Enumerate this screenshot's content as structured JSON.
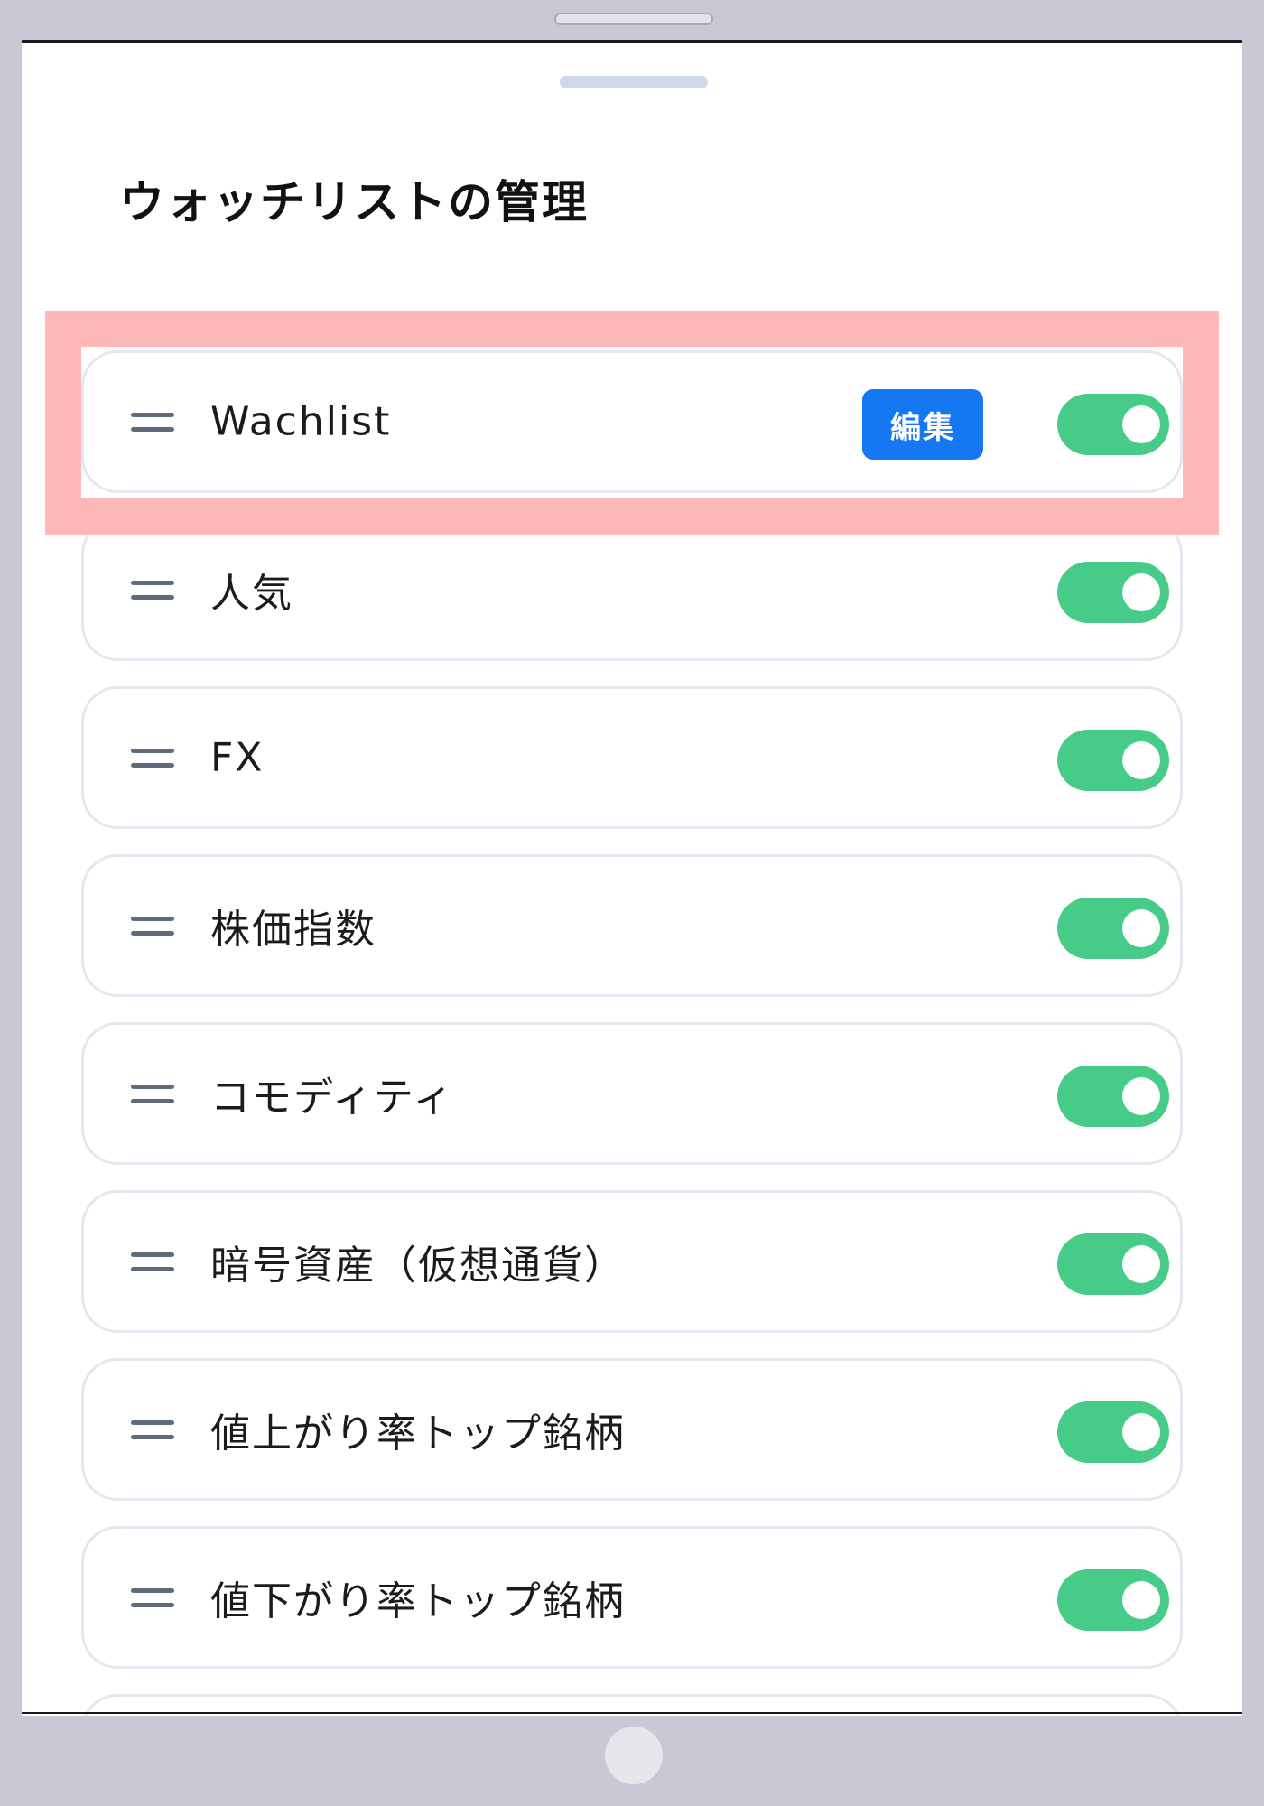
{
  "sheet": {
    "title": "ウォッチリストの管理"
  },
  "watchlists": [
    {
      "label": "Wachlist",
      "edit_label": "編集",
      "enabled": true
    },
    {
      "label": "人気",
      "enabled": true
    },
    {
      "label": "FX",
      "enabled": true
    },
    {
      "label": "株価指数",
      "enabled": true
    },
    {
      "label": "コモディティ",
      "enabled": true
    },
    {
      "label": "暗号資産（仮想通貨）",
      "enabled": true
    },
    {
      "label": "値上がり率トップ銘柄",
      "enabled": true
    },
    {
      "label": "値下がり率トップ銘柄",
      "enabled": true
    }
  ],
  "colors": {
    "toggle_on": "#46cc88",
    "edit_button": "#1677f2",
    "highlight": "#ffb8b8",
    "device_frame": "#c9c9d6"
  },
  "icons": {
    "drag_handle": "drag-handle-icon"
  }
}
